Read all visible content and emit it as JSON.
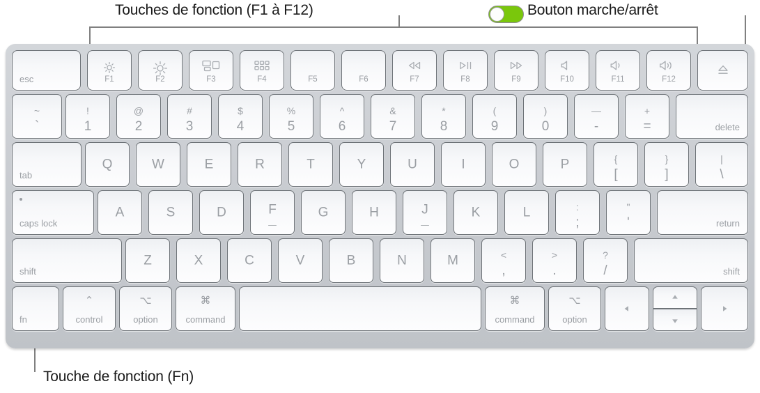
{
  "callouts": {
    "function_keys": "Touches de fonction (F1 à F12)",
    "power_button": "Bouton marche/arrêt",
    "fn_key": "Touche de fonction (Fn)"
  },
  "colors": {
    "toggle_on": "#7AC70C",
    "keyboard_body": "#C9CCD1",
    "key_face": "#F7F8FA",
    "legend_text": "#A0A4A9",
    "leader_line": "#808080",
    "caption_text": "#1A1A1A"
  },
  "keyboard": {
    "layout": "Magic Keyboard — US ANSI",
    "rows": [
      {
        "name": "function-row",
        "keys": [
          {
            "name": "esc",
            "label": "esc"
          },
          {
            "name": "f1",
            "fnum": "F1",
            "icon": "brightness-down-icon"
          },
          {
            "name": "f2",
            "fnum": "F2",
            "icon": "brightness-up-icon"
          },
          {
            "name": "f3",
            "fnum": "F3",
            "icon": "mission-control-icon"
          },
          {
            "name": "f4",
            "fnum": "F4",
            "icon": "launchpad-icon"
          },
          {
            "name": "f5",
            "fnum": "F5",
            "icon": ""
          },
          {
            "name": "f6",
            "fnum": "F6",
            "icon": ""
          },
          {
            "name": "f7",
            "fnum": "F7",
            "icon": "rewind-icon"
          },
          {
            "name": "f8",
            "fnum": "F8",
            "icon": "play-pause-icon"
          },
          {
            "name": "f9",
            "fnum": "F9",
            "icon": "fast-forward-icon"
          },
          {
            "name": "f10",
            "fnum": "F10",
            "icon": "volume-mute-icon"
          },
          {
            "name": "f11",
            "fnum": "F11",
            "icon": "volume-down-icon"
          },
          {
            "name": "f12",
            "fnum": "F12",
            "icon": "volume-up-icon"
          },
          {
            "name": "power",
            "icon": "eject-icon"
          }
        ]
      },
      {
        "name": "number-row",
        "keys": [
          {
            "name": "backtick",
            "top": "~",
            "bottom": "`"
          },
          {
            "name": "digit-1",
            "top": "!",
            "bottom": "1"
          },
          {
            "name": "digit-2",
            "top": "@",
            "bottom": "2"
          },
          {
            "name": "digit-3",
            "top": "#",
            "bottom": "3"
          },
          {
            "name": "digit-4",
            "top": "$",
            "bottom": "4"
          },
          {
            "name": "digit-5",
            "top": "%",
            "bottom": "5"
          },
          {
            "name": "digit-6",
            "top": "^",
            "bottom": "6"
          },
          {
            "name": "digit-7",
            "top": "&",
            "bottom": "7"
          },
          {
            "name": "digit-8",
            "top": "*",
            "bottom": "8"
          },
          {
            "name": "digit-9",
            "top": "(",
            "bottom": "9"
          },
          {
            "name": "digit-0",
            "top": ")",
            "bottom": "0"
          },
          {
            "name": "minus",
            "top": "—",
            "bottom": "-"
          },
          {
            "name": "equals",
            "top": "+",
            "bottom": "="
          },
          {
            "name": "delete",
            "label": "delete"
          }
        ]
      },
      {
        "name": "tab-row",
        "keys": [
          {
            "name": "tab",
            "label": "tab"
          },
          {
            "name": "q",
            "main": "Q"
          },
          {
            "name": "w",
            "main": "W"
          },
          {
            "name": "e",
            "main": "E"
          },
          {
            "name": "r",
            "main": "R"
          },
          {
            "name": "t",
            "main": "T"
          },
          {
            "name": "y",
            "main": "Y"
          },
          {
            "name": "u",
            "main": "U"
          },
          {
            "name": "i",
            "main": "I"
          },
          {
            "name": "o",
            "main": "O"
          },
          {
            "name": "p",
            "main": "P"
          },
          {
            "name": "bracket-left",
            "top": "{",
            "bottom": "["
          },
          {
            "name": "bracket-right",
            "top": "}",
            "bottom": "]"
          },
          {
            "name": "backslash",
            "top": "|",
            "bottom": "\\"
          }
        ]
      },
      {
        "name": "home-row",
        "keys": [
          {
            "name": "caps-lock",
            "label": "caps lock"
          },
          {
            "name": "a",
            "main": "A"
          },
          {
            "name": "s",
            "main": "S"
          },
          {
            "name": "d",
            "main": "D"
          },
          {
            "name": "f",
            "main": "F",
            "homing": true
          },
          {
            "name": "g",
            "main": "G"
          },
          {
            "name": "h",
            "main": "H"
          },
          {
            "name": "j",
            "main": "J",
            "homing": true
          },
          {
            "name": "k",
            "main": "K"
          },
          {
            "name": "l",
            "main": "L"
          },
          {
            "name": "semicolon",
            "top": ":",
            "bottom": ";"
          },
          {
            "name": "quote",
            "top": "\"",
            "bottom": "'"
          },
          {
            "name": "return",
            "label": "return"
          }
        ]
      },
      {
        "name": "shift-row",
        "keys": [
          {
            "name": "shift-left",
            "label": "shift"
          },
          {
            "name": "z",
            "main": "Z"
          },
          {
            "name": "x",
            "main": "X"
          },
          {
            "name": "c",
            "main": "C"
          },
          {
            "name": "v",
            "main": "V"
          },
          {
            "name": "b",
            "main": "B"
          },
          {
            "name": "n",
            "main": "N"
          },
          {
            "name": "m",
            "main": "M"
          },
          {
            "name": "comma",
            "top": "<",
            "bottom": ","
          },
          {
            "name": "period",
            "top": ">",
            "bottom": "."
          },
          {
            "name": "slash",
            "top": "?",
            "bottom": "/"
          },
          {
            "name": "shift-right",
            "label": "shift"
          }
        ]
      },
      {
        "name": "bottom-row",
        "keys": [
          {
            "name": "fn",
            "label": "fn"
          },
          {
            "name": "control-left",
            "label": "control",
            "sym": "⌃"
          },
          {
            "name": "option-left",
            "label": "option",
            "sym": "⌥"
          },
          {
            "name": "command-left",
            "label": "command",
            "sym": "⌘"
          },
          {
            "name": "space",
            "label": ""
          },
          {
            "name": "command-right",
            "label": "command",
            "sym": "⌘"
          },
          {
            "name": "option-right",
            "label": "option",
            "sym": "⌥"
          },
          {
            "name": "arrow-left",
            "icon": "arrow-left-icon"
          },
          {
            "name": "arrow-up",
            "icon": "arrow-up-icon"
          },
          {
            "name": "arrow-down",
            "icon": "arrow-down-icon"
          },
          {
            "name": "arrow-right",
            "icon": "arrow-right-icon"
          }
        ]
      }
    ]
  }
}
